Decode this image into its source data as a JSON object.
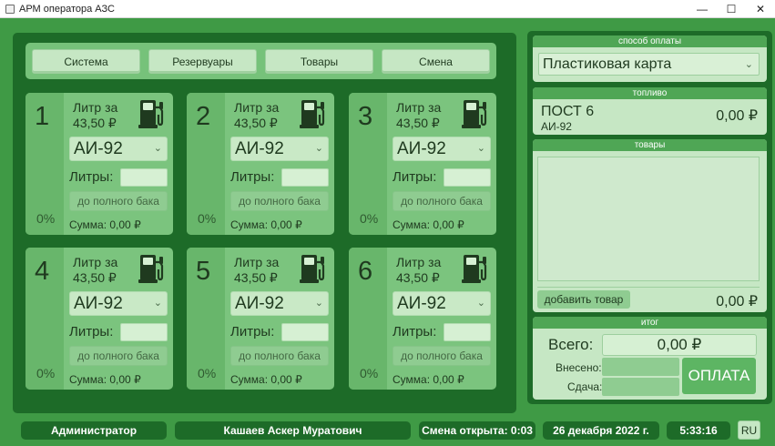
{
  "window": {
    "title": "АРМ оператора АЗС",
    "minimize": "—",
    "maximize": "☐",
    "close": "✕"
  },
  "menu": [
    "Система",
    "Резервуары",
    "Товары",
    "Смена"
  ],
  "pumps": [
    {
      "number": "1",
      "price_label": "Литр за",
      "price": "43,50 ₽",
      "fuel": "АИ-92",
      "liters_label": "Литры:",
      "full_tank": "до полного бака",
      "sum": "Сумма: 0,00 ₽",
      "percent": "0%"
    },
    {
      "number": "2",
      "price_label": "Литр за",
      "price": "43,50 ₽",
      "fuel": "АИ-92",
      "liters_label": "Литры:",
      "full_tank": "до полного бака",
      "sum": "Сумма: 0,00 ₽",
      "percent": "0%"
    },
    {
      "number": "3",
      "price_label": "Литр за",
      "price": "43,50 ₽",
      "fuel": "АИ-92",
      "liters_label": "Литры:",
      "full_tank": "до полного бака",
      "sum": "Сумма: 0,00 ₽",
      "percent": "0%"
    },
    {
      "number": "4",
      "price_label": "Литр за",
      "price": "43,50 ₽",
      "fuel": "АИ-92",
      "liters_label": "Литры:",
      "full_tank": "до полного бака",
      "sum": "Сумма: 0,00 ₽",
      "percent": "0%"
    },
    {
      "number": "5",
      "price_label": "Литр за",
      "price": "43,50 ₽",
      "fuel": "АИ-92",
      "liters_label": "Литры:",
      "full_tank": "до полного бака",
      "sum": "Сумма: 0,00 ₽",
      "percent": "0%"
    },
    {
      "number": "6",
      "price_label": "Литр за",
      "price": "43,50 ₽",
      "fuel": "АИ-92",
      "liters_label": "Литры:",
      "full_tank": "до полного бака",
      "sum": "Сумма: 0,00 ₽",
      "percent": "0%"
    }
  ],
  "payment": {
    "header": "способ оплаты",
    "method": "Пластиковая карта"
  },
  "fuel_section": {
    "header": "топливо",
    "post": "ПОСТ 6",
    "fuel": "АИ-92",
    "sum": "0,00 ₽"
  },
  "goods": {
    "header": "товары",
    "add_button": "добавить товар",
    "sum": "0,00 ₽"
  },
  "total": {
    "header": "итог",
    "total_label": "Всего:",
    "total_value": "0,00 ₽",
    "paid_label": "Внесено:",
    "change_label": "Сдача:",
    "pay_button": "ОПЛАТА"
  },
  "status": {
    "role": "Администратор",
    "operator": "Кашаев Аскер Муратович",
    "shift": "Смена открыта: 0:03",
    "date": "26 декабря 2022 г.",
    "time": "5:33:16",
    "language": "RU"
  },
  "icons": {
    "pump": "fuel-pump-icon",
    "chevron": "chevron-down-icon"
  },
  "colors": {
    "window_bg": "#3f9a45",
    "frame": "#1d6b28",
    "card": "#7bc47e",
    "header": "#4fa655",
    "light": "#c6e7c4"
  }
}
